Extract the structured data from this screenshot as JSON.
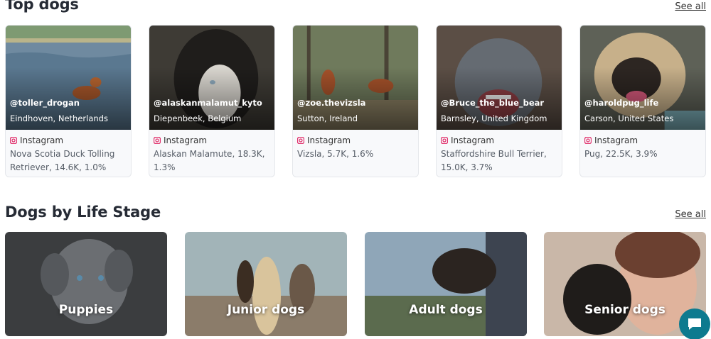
{
  "top_dogs": {
    "title": "Top dogs",
    "see_all": "See all",
    "cards": [
      {
        "handle": "@toller_drogan",
        "location": "Eindhoven, Netherlands",
        "source": "Instagram",
        "description": "Nova Scotia Duck Tolling Retriever, 14.6K, 1.0%"
      },
      {
        "handle": "@alaskanmalamut_kyto",
        "location": "Diepenbeek, Belgium",
        "source": "Instagram",
        "description": "Alaskan Malamute, 18.3K, 1.3%"
      },
      {
        "handle": "@zoe.thevizsla",
        "location": "Sutton, Ireland",
        "source": "Instagram",
        "description": "Vizsla, 5.7K, 1.6%"
      },
      {
        "handle": "@Bruce_the_blue_bear",
        "location": "Barnsley, United Kingdom",
        "source": "Instagram",
        "description": "Staffordshire Bull Terrier, 15.0K, 3.7%"
      },
      {
        "handle": "@haroldpug_life",
        "location": "Carson, United States",
        "source": "Instagram",
        "description": "Pug, 22.5K, 3.9%"
      }
    ]
  },
  "life_stage": {
    "title": "Dogs by Life Stage",
    "see_all": "See all",
    "cards": [
      {
        "label": "Puppies"
      },
      {
        "label": "Junior dogs"
      },
      {
        "label": "Adult dogs"
      },
      {
        "label": "Senior dogs"
      }
    ]
  },
  "colors": {
    "accent": "#0d7a8f",
    "instagram": "#e1306c"
  },
  "icons": {
    "source": "instagram-icon",
    "chat": "chat-bubble-icon"
  }
}
